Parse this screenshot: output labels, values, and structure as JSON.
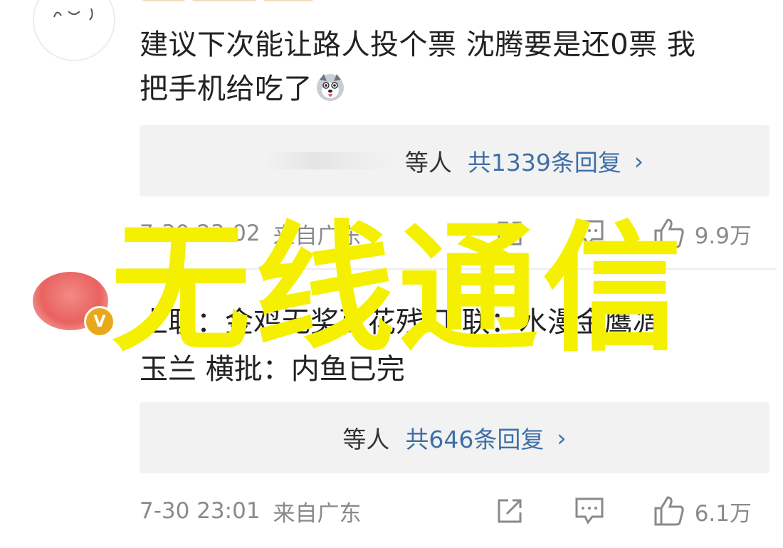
{
  "comments": [
    {
      "text_line1": "建议下次能让路人投个票 沈腾要是还0票 我",
      "text_line2": "把手机给吃了",
      "emoji": "husky-dog-emoji",
      "replies": {
        "who": "等人",
        "count_label": "共1339条回复",
        "chevron": "›"
      },
      "time": "7-30 23:02",
      "location": "来自广东",
      "likes": "9.9万"
    },
    {
      "text_line1": "上联：金鸡无奖百花残 下联：水漫金鹰凋",
      "text_line2": "玉兰 横批：内鱼已完",
      "verified_badge": "V",
      "replies": {
        "who": "等人",
        "count_label": "共646条回复",
        "chevron": "›"
      },
      "time": "7-30 23:01",
      "location": "来自广东",
      "likes": "6.1万"
    }
  ],
  "watermark": "无线通信",
  "colors": {
    "link": "#3f6fa8",
    "watermark": "#f4f000",
    "badge": "#e9a81c",
    "meta": "#8a8a8a"
  },
  "icons": [
    "share-icon",
    "comment-icon",
    "like-icon"
  ]
}
